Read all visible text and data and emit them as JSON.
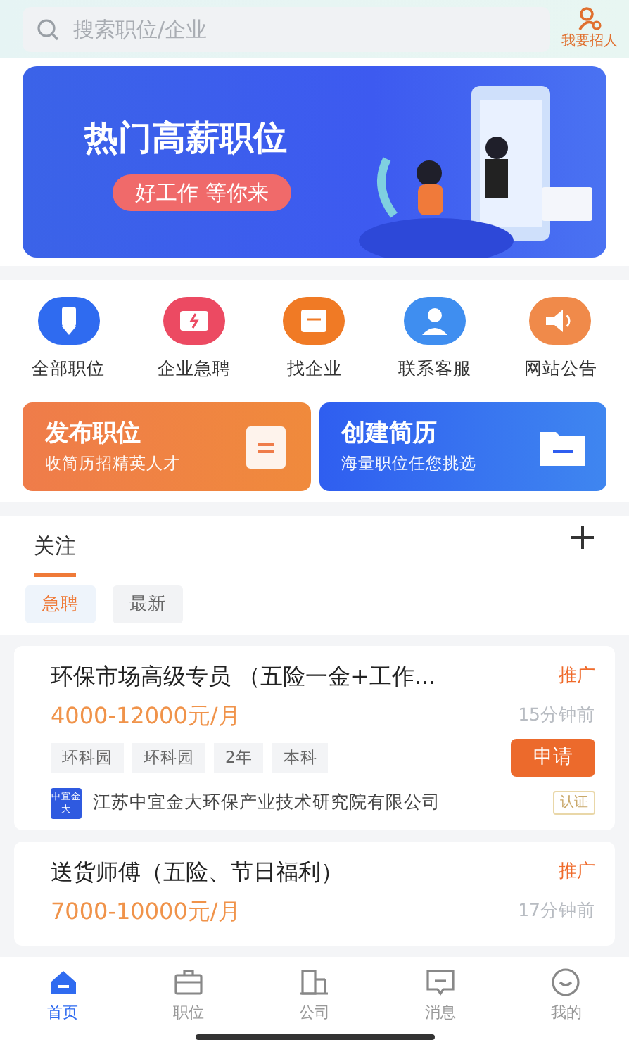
{
  "search": {
    "placeholder": "搜索职位/企业"
  },
  "recruit_button": {
    "label": "我要招人"
  },
  "banner": {
    "title": "热门高薪职位",
    "slogan": "好工作 等你来"
  },
  "quick_links": [
    {
      "label": "全部职位",
      "color": "#2f6bf0"
    },
    {
      "label": "企业急聘",
      "color": "#ec4a62"
    },
    {
      "label": "找企业",
      "color": "#f07a25"
    },
    {
      "label": "联系客服",
      "color": "#3f8ef0"
    },
    {
      "label": "网站公告",
      "color": "#f08a4a"
    }
  ],
  "action_cards": [
    {
      "kind": "post",
      "title": "发布职位",
      "subtitle": "收简历招精英人才"
    },
    {
      "kind": "resume",
      "title": "创建简历",
      "subtitle": "海量职位任您挑选"
    }
  ],
  "section_tabs": [
    {
      "label": "关注",
      "selected": true
    }
  ],
  "filters": [
    {
      "label": "急聘",
      "selected": true
    },
    {
      "label": "最新",
      "selected": false
    }
  ],
  "jobs": [
    {
      "title": "环保市场高级专员 （五险一金+工作...",
      "badge": "推广",
      "salary": "4000-12000元/月",
      "time": "15分钟前",
      "tags": [
        "环科园",
        "环科园",
        "2年",
        "本科"
      ],
      "apply": "申请",
      "logo": "中宜金大",
      "company": "江苏中宜金大环保产业技术研究院有限公司",
      "verified": "认证"
    },
    {
      "title": "送货师傅（五险、节日福利）",
      "badge": "推广",
      "salary": "7000-10000元/月",
      "time": "17分钟前"
    }
  ],
  "tab_bar": [
    {
      "label": "首页",
      "selected": true
    },
    {
      "label": "职位",
      "selected": false
    },
    {
      "label": "公司",
      "selected": false
    },
    {
      "label": "消息",
      "selected": false
    },
    {
      "label": "我的",
      "selected": false
    }
  ]
}
